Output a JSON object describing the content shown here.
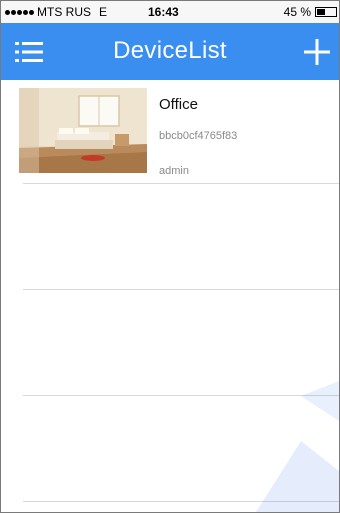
{
  "status_bar": {
    "carrier": "MTS RUS",
    "network": "E",
    "time": "16:43",
    "battery_text": "45 %",
    "battery_level": 0.45
  },
  "navbar": {
    "title": "DeviceList",
    "menu_icon": "list-menu-icon",
    "add_icon": "plus-icon",
    "color": "#3a8ef0"
  },
  "devices": [
    {
      "name": "Office",
      "id": "bbcb0cf4765f83",
      "user": "admin",
      "thumbnail": "bedroom-camera-thumbnail"
    }
  ]
}
